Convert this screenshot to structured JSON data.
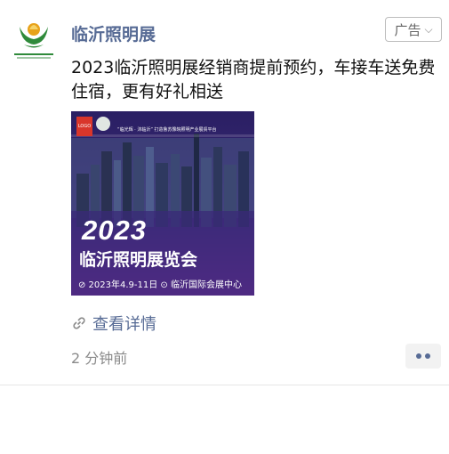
{
  "post": {
    "avatar_icon": "linyi-lighting-logo",
    "author": "临沂照明展",
    "ad_label": "广告",
    "content": "2023临沂照明展经销商提前预约，车接车送免费住宿，更有好礼相送",
    "poster": {
      "year": "2023",
      "title": "临沂照明展览会",
      "info": "⊘ 2023年4.9-11日 ⊙ 临沂国际会展中心",
      "slogan": "“临光辉 · 沐临沂” 打造鲁苏豫皖照明产业展贸平台"
    },
    "link_label": "查看详情",
    "time": "2 分钟前",
    "colors": {
      "link": "#576b95",
      "poster_top": "#2a1f63",
      "poster_bottom": "#8b2ea0"
    }
  }
}
